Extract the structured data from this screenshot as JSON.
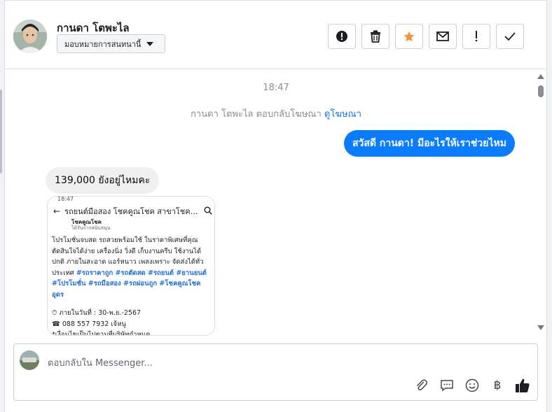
{
  "header": {
    "contact_name": "กานดา โตพะไล",
    "assign_label": "มอบหมายการสนทนานี้",
    "actions": [
      {
        "name": "report-button",
        "icon": "alert-circle-icon"
      },
      {
        "name": "delete-button",
        "icon": "trash-icon"
      },
      {
        "name": "star-button",
        "icon": "star-icon"
      },
      {
        "name": "mark-unread-button",
        "icon": "envelope-icon"
      },
      {
        "name": "important-button",
        "icon": "exclamation-icon"
      },
      {
        "name": "mark-done-button",
        "icon": "checkmark-icon"
      }
    ]
  },
  "messages": {
    "timestamp": "18:47",
    "system_note_prefix": "กานดา โตพะไล ตอบกลับโฆษณา",
    "system_note_link": "ดูโฆษณา",
    "outgoing": "สวัสดี กานดา! มีอะไรให้เราช่วยไหม",
    "incoming": "139,000 ยังอยู่ไหมคะ",
    "attachment": {
      "status_time": "18:47",
      "title": "รถยนต์มือสอง โชคคูณโชค สาขาโชคคูณโชค",
      "page_name": "โชคคูณโชค",
      "page_sub": "ได้รับการสนับสนุน",
      "body_lines": [
        "โปรโมชั่นจบสด รถสวยพร้อมใช้ ในราคาพิเศษที่คุณ",
        "ตัดสินใจได้ง่าย เครื่องนิ่ง วิ่งดี เก็บงานครีบ ใช้งานได้",
        "ปกติ ภายในสะอาด แอร์หนาว เพลงเพราะ จัดส่งได้ทั่ว"
      ],
      "body_prefix": "ประเทศ",
      "tags_line1": "#รถราคาถูก #รถตัดสด #รถยนต์ #ยานยนต์",
      "tags_line2": "#โปรโมชั่น #รถมือสอง #รถผ่อนถูก #โชคคูณโชค",
      "tags_line3": "อุดร",
      "valid_until": "ภายในวันที่ : 30-พ.ย.-2567",
      "phone": "088 557 7932 เจ้หนู",
      "condition": "*เงื่อนไขเป็นไปตามที่บริษัทกำหนด"
    }
  },
  "composer": {
    "placeholder": "ตอบกลับใน Messenger...",
    "tools": [
      {
        "name": "attach-icon",
        "glyph": "📎"
      },
      {
        "name": "saved-replies-icon",
        "glyph": "💬"
      },
      {
        "name": "emoji-icon",
        "glyph": "☺"
      },
      {
        "name": "baht-icon",
        "glyph": "฿"
      },
      {
        "name": "like-icon",
        "glyph": "👍"
      }
    ]
  },
  "colors": {
    "accent": "#0a7cff",
    "link": "#1877f2",
    "star": "#f7923b",
    "tag": "#216fdb"
  }
}
